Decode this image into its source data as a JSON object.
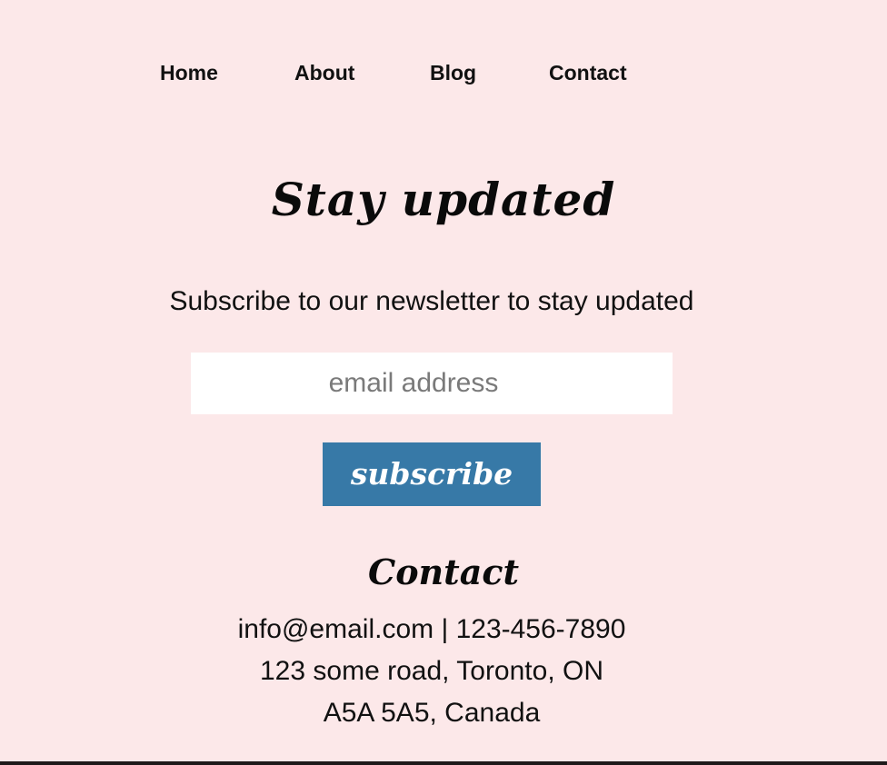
{
  "nav": {
    "items": [
      {
        "label": "Home"
      },
      {
        "label": "About"
      },
      {
        "label": "Blog"
      },
      {
        "label": "Contact"
      }
    ]
  },
  "newsletter": {
    "heading": "Stay updated",
    "subtext": "Subscribe to our newsletter to stay updated",
    "email_value": "",
    "email_placeholder": "email address",
    "subscribe_label": "subscribe"
  },
  "contact": {
    "heading": "Contact",
    "line1": "info@email.com | 123-456-7890",
    "line2": "123 some road, Toronto, ON",
    "line3": "A5A 5A5, Canada"
  },
  "colors": {
    "background": "#fce8e9",
    "button": "#3779a7",
    "text": "#111111"
  }
}
